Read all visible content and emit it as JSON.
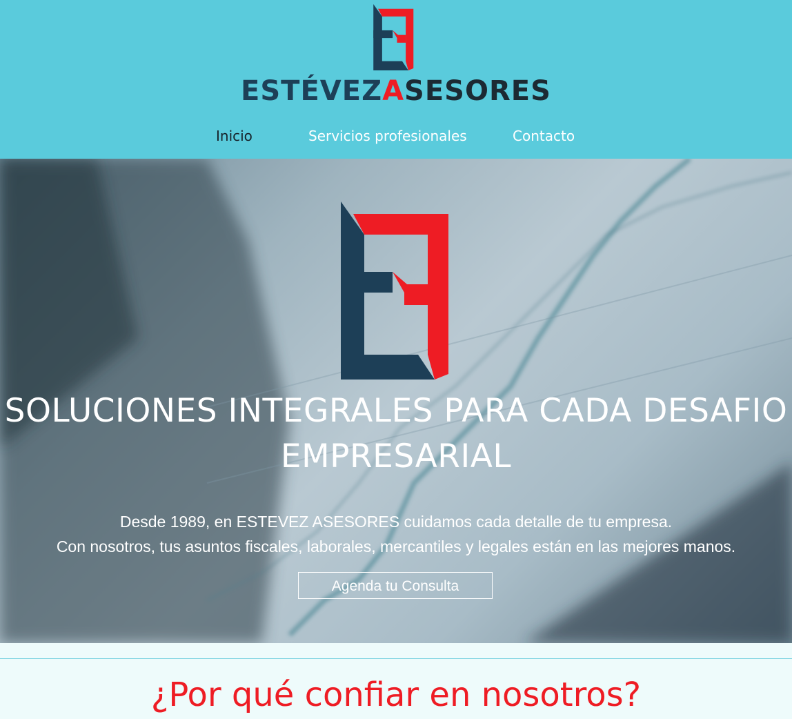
{
  "header": {
    "brand_prefix": "ESTÉVEZ",
    "brand_mid": "A",
    "brand_suffix": "SESORES",
    "nav": [
      {
        "label": "Inicio"
      },
      {
        "label": "Servicios profesionales"
      },
      {
        "label": "Contacto"
      }
    ]
  },
  "hero": {
    "title": "SOLUCIONES INTEGRALES PARA CADA DESAFIO EMPRESARIAL",
    "line1": "Desde 1989, en ESTEVEZ ASESORES cuidamos cada detalle de tu empresa.",
    "line2": "Con nosotros, tus asuntos fiscales, laborales, mercantiles y legales están en las mejores manos.",
    "cta_label": "Agenda tu Consulta"
  },
  "section": {
    "title": "¿Por qué confiar en nosotros?"
  },
  "colors": {
    "header_bg": "#5acbdc",
    "brand_navy": "#1d3f57",
    "brand_red": "#ee1c24",
    "page_bg": "#eefbfb"
  }
}
